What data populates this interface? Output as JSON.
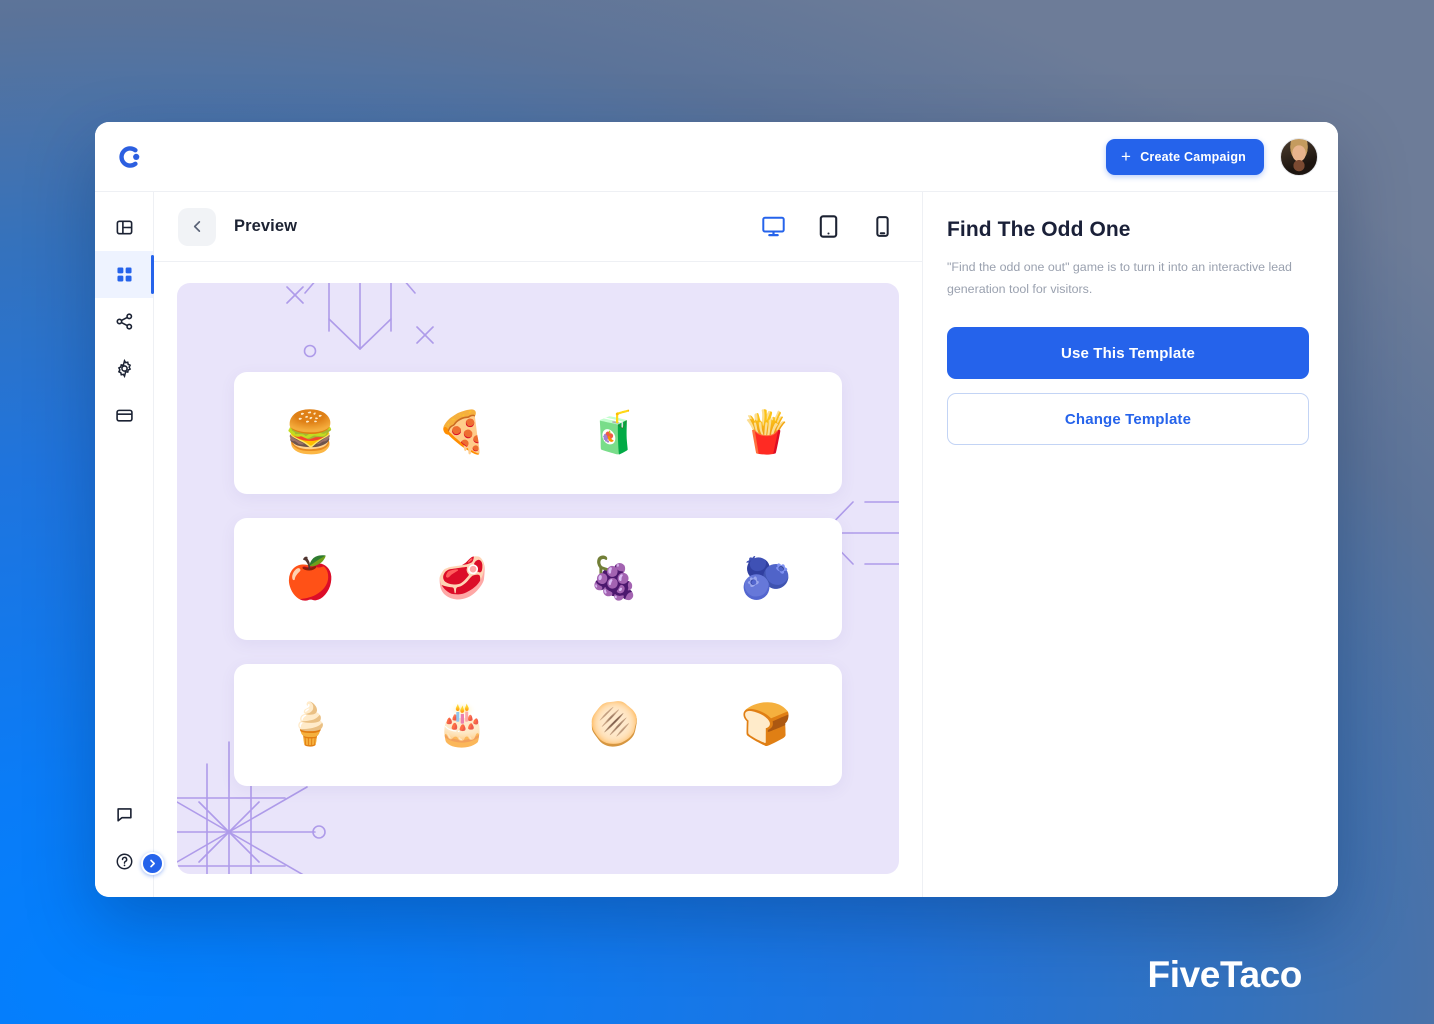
{
  "brand": {
    "logo_icon": "c-dot-logo-icon",
    "watermark": "FiveTaco"
  },
  "topbar": {
    "create_campaign_label": "Create Campaign",
    "plus_icon": "plus-icon",
    "avatar_icon": "user-avatar"
  },
  "sidebar": {
    "items": [
      {
        "name": "layout-panel-icon",
        "label": "Layout",
        "active": false
      },
      {
        "name": "grid-icon",
        "label": "Templates",
        "active": true
      },
      {
        "name": "share-icon",
        "label": "Share",
        "active": false
      },
      {
        "name": "gear-icon",
        "label": "Settings",
        "active": false
      },
      {
        "name": "credit-card-icon",
        "label": "Billing",
        "active": false
      }
    ],
    "bottom_items": [
      {
        "name": "chat-bubble-icon",
        "label": "Feedback"
      },
      {
        "name": "help-circle-icon",
        "label": "Help"
      }
    ],
    "expand_button": "chevron-right-icon"
  },
  "preview": {
    "back_icon": "chevron-left-icon",
    "title": "Preview",
    "devices": [
      {
        "name": "desktop-icon",
        "label": "Desktop",
        "active": true
      },
      {
        "name": "tablet-icon",
        "label": "Tablet",
        "active": false
      },
      {
        "name": "mobile-icon",
        "label": "Mobile",
        "active": false
      }
    ]
  },
  "game": {
    "background_color": "#e9e4fa",
    "decorations": [
      "snowflake-top",
      "snowflake-right",
      "snowflake-bottom-left"
    ],
    "rows": [
      {
        "items": [
          {
            "name": "hamburger-emoji",
            "glyph": "🍔"
          },
          {
            "name": "pizza-emoji",
            "glyph": "🍕"
          },
          {
            "name": "juice-glass-emoji",
            "glyph": "🧃"
          },
          {
            "name": "french-fries-emoji",
            "glyph": "🍟"
          }
        ]
      },
      {
        "items": [
          {
            "name": "apple-emoji",
            "glyph": "🍎"
          },
          {
            "name": "steak-emoji",
            "glyph": "🥩"
          },
          {
            "name": "grapes-emoji",
            "glyph": "🍇"
          },
          {
            "name": "blueberries-emoji",
            "glyph": "🫐"
          }
        ]
      },
      {
        "items": [
          {
            "name": "ice-cream-cone-emoji",
            "glyph": "🍦"
          },
          {
            "name": "birthday-cake-emoji",
            "glyph": "🎂"
          },
          {
            "name": "hot-bread-emoji",
            "glyph": "🫓"
          },
          {
            "name": "bread-slice-emoji",
            "glyph": "🍞"
          }
        ]
      }
    ]
  },
  "info": {
    "title": "Find The Odd One",
    "description": "\"Find the odd one out\" game is to turn it into an interactive lead generation tool for visitors.",
    "use_template_label": "Use This Template",
    "change_template_label": "Change Template"
  },
  "colors": {
    "accent": "#2563eb",
    "canvas": "#e9e4fa",
    "deco": "#8b6fe0",
    "page_gradient_from": "#6d7c98",
    "page_gradient_to": "#0280ff"
  }
}
